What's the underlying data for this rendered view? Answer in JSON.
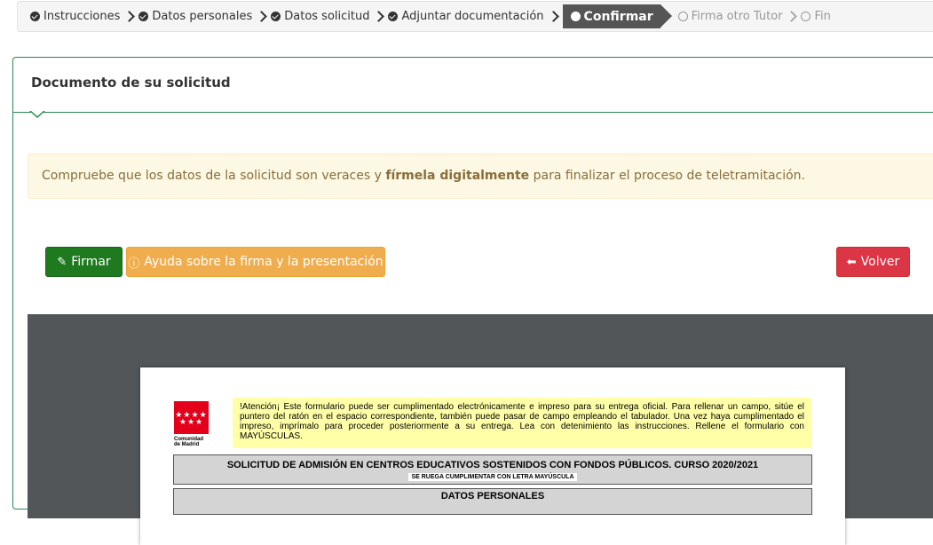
{
  "stepper": {
    "steps": [
      {
        "label": "Instrucciones",
        "state": "done"
      },
      {
        "label": "Datos personales",
        "state": "done"
      },
      {
        "label": "Datos solicitud",
        "state": "done"
      },
      {
        "label": "Adjuntar documentación",
        "state": "done"
      },
      {
        "label": "Confirmar",
        "state": "active"
      },
      {
        "label": "Firma otro Tutor",
        "state": "todo"
      },
      {
        "label": "Fin",
        "state": "todo"
      }
    ]
  },
  "panel": {
    "title": "Documento de su solicitud",
    "alert": {
      "part1": "Compruebe que los datos de la solicitud son veraces y ",
      "bold": "fírmela digitalmente",
      "part2": " para finalizar el proceso de teletramitación."
    }
  },
  "buttons": {
    "sign": "Firmar",
    "help": "Ayuda sobre la firma y la presentación",
    "back": "Volver"
  },
  "colors": {
    "panel_border": "#2a8a52",
    "sign": "#1f7a1f",
    "help": "#f0ad4e",
    "back": "#dc3545",
    "viewer_bg": "#525659"
  },
  "document": {
    "logo_text": "Comunidad de Madrid",
    "notice": "!Atención¡ Este formulario puede ser cumplimentado electrónicamente e impreso para su entrega oficial. Para rellenar un campo, sitúe el puntero del ratón en el espacio correspondiente, también puede pasar de campo empleando el tabulador. Una vez haya cumplimentado el impreso, imprímalo para proceder posteriormente a su entrega. Lea con detenimiento las instrucciones. Rellene el formulario con MAYÚSCULAS.",
    "form_title": "SOLICITUD DE ADMISIÓN EN CENTROS EDUCATIVOS SOSTENIDOS CON FONDOS PÚBLICOS. CURSO 2020/2021",
    "form_subtitle": "SE RUEGA CUMPLIMENTAR CON LETRA MAYÚSCULA",
    "section_title": "DATOS PERSONALES"
  }
}
